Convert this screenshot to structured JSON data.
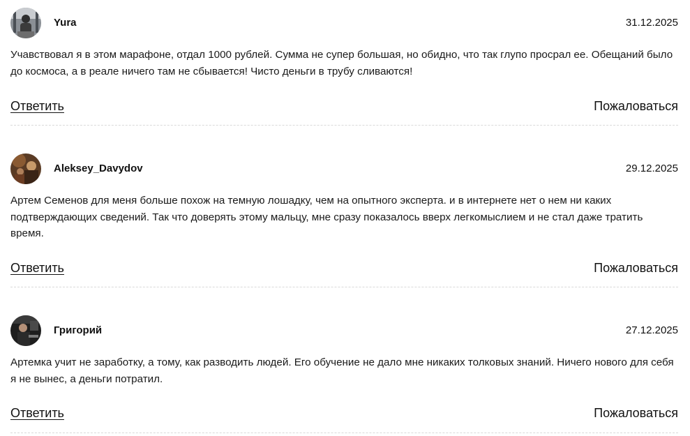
{
  "comments": [
    {
      "author": "Yura",
      "date": "31.12.2025",
      "text": "Учавствовал я в этом марафоне, отдал 1000 рублей. Сумма не супер большая, но обидно, что так глупо просрал ее. Обещаний было до космоса, а в реале ничего там не сбывается! Чисто деньги в трубу сливаются!",
      "reply_label": "Ответить",
      "report_label": "Пожаловаться"
    },
    {
      "author": "Aleksey_Davydov",
      "date": "29.12.2025",
      "text": "Артем Семенов для меня больше похож на темную лошадку, чем на опытного эксперта. и в интернете нет о нем ни каких подтверждающих сведений. Так что доверять этому мальцу, мне сразу показалось вверх легкомыслием и не стал даже тратить время.",
      "reply_label": "Ответить",
      "report_label": "Пожаловаться"
    },
    {
      "author": "Григорий",
      "date": "27.12.2025",
      "text": "Артемка учит не заработку, а тому, как разводить людей. Его обучение не дало мне никаких толковых знаний. Ничего нового для себя я не вынес, а деньги потратил.",
      "reply_label": "Ответить",
      "report_label": "Пожаловаться"
    }
  ]
}
